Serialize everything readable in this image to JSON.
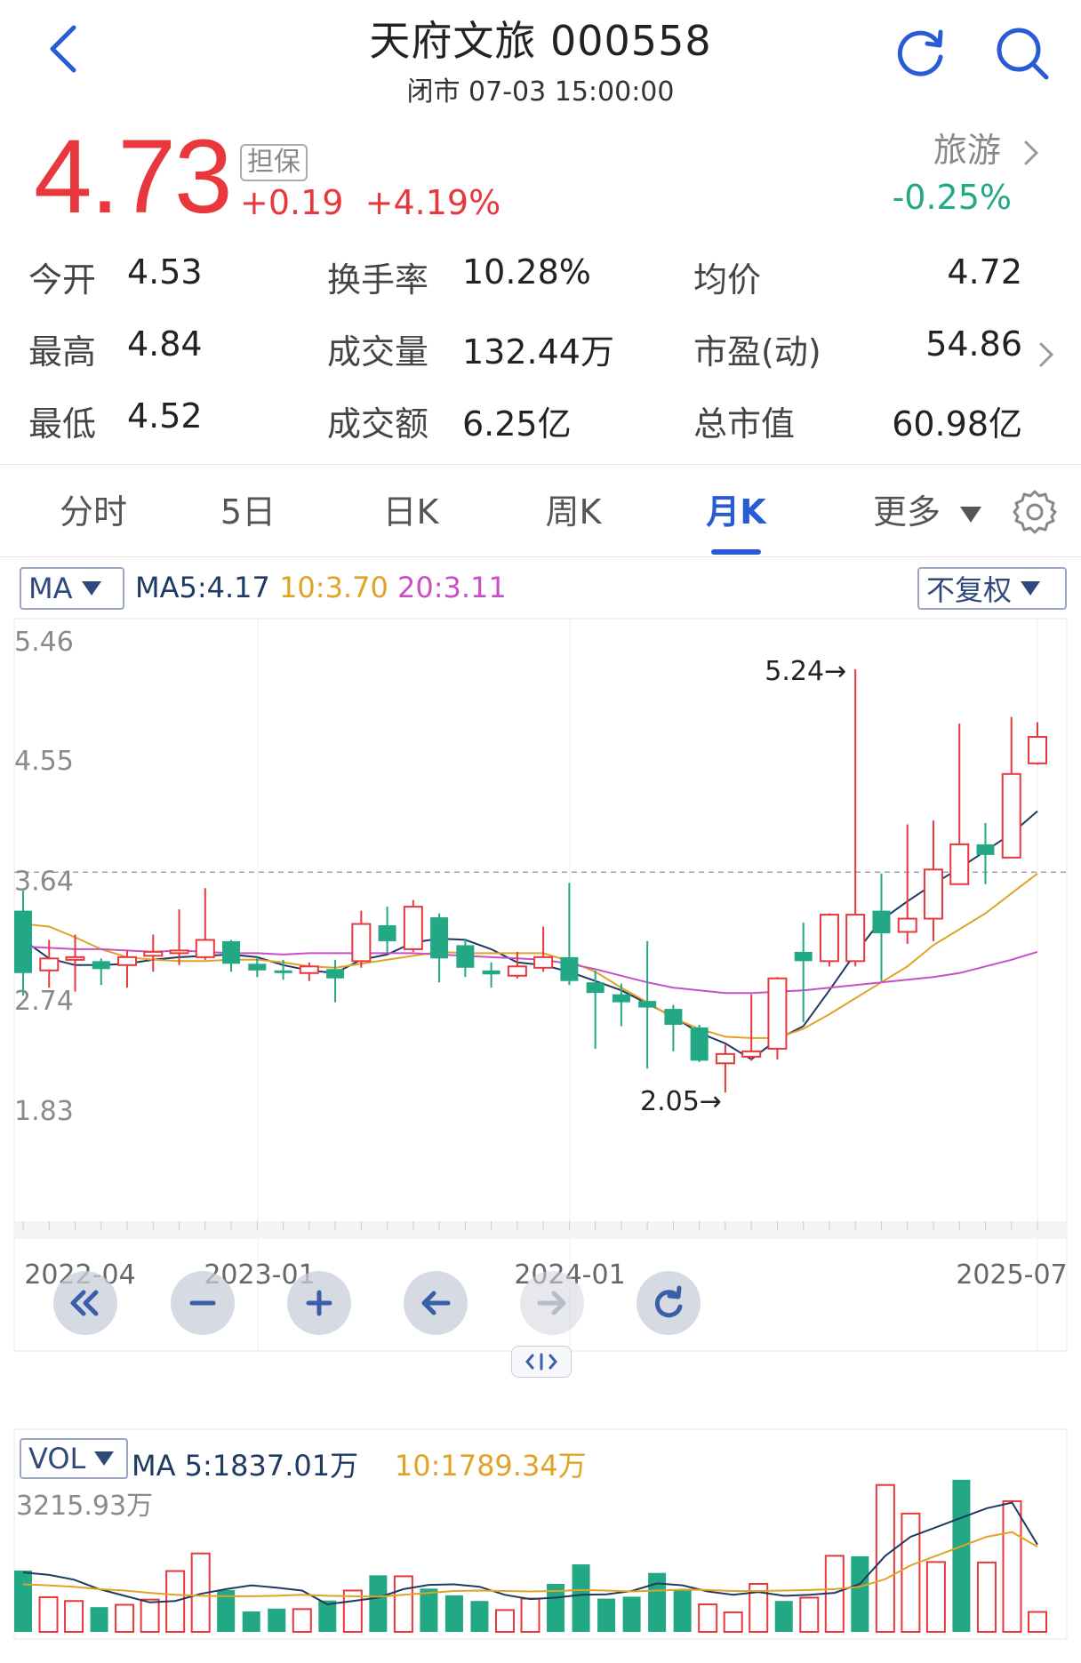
{
  "header": {
    "title": "天府文旅 000558",
    "subtitle": "闭市 07-03 15:00:00",
    "back_icon": "chevron-left-icon",
    "refresh_icon": "refresh-icon",
    "search_icon": "search-icon"
  },
  "quote": {
    "price": "4.73",
    "badge": "担保",
    "change": "+0.19",
    "change_pct": "+4.19%",
    "sector": "旅游",
    "sector_change": "-0.25%"
  },
  "stats": [
    {
      "label": "今开",
      "value": "4.53",
      "tone": "green"
    },
    {
      "label": "换手率",
      "value": "10.28%",
      "tone": "plain"
    },
    {
      "label": "均价",
      "value": "4.72",
      "tone": "red"
    },
    {
      "label": "最高",
      "value": "4.84",
      "tone": "red"
    },
    {
      "label": "成交量",
      "value": "132.44万",
      "tone": "plain"
    },
    {
      "label": "市盈(动)",
      "value": "54.86",
      "tone": "plain"
    },
    {
      "label": "最低",
      "value": "4.52",
      "tone": "green"
    },
    {
      "label": "成交额",
      "value": "6.25亿",
      "tone": "plain"
    },
    {
      "label": "总市值",
      "value": "60.98亿",
      "tone": "plain"
    }
  ],
  "tabs": [
    {
      "label": "分时",
      "active": false
    },
    {
      "label": "5日",
      "active": false
    },
    {
      "label": "日K",
      "active": false
    },
    {
      "label": "周K",
      "active": false
    },
    {
      "label": "月K",
      "active": true
    },
    {
      "label": "更多",
      "active": false
    }
  ],
  "chart_controls": {
    "indicator": "MA",
    "ma5": "MA5:4.17",
    "ma10": "10:3.70",
    "ma20": "20:3.11",
    "adjust": "不复权",
    "vol_indicator": "VOL",
    "vol_ma5": "MA 5:1837.01万",
    "vol_ma10": "10:1789.34万"
  },
  "colors": {
    "up": "#e8383d",
    "down": "#22a884",
    "ma5": "#1f3a63",
    "ma10": "#e0a325",
    "ma20": "#c84fc6",
    "accent": "#2a5bd7"
  },
  "chart_data": {
    "type": "candlestick",
    "period": "monthly",
    "y_ticks": [
      "5.46",
      "4.55",
      "3.64",
      "2.74",
      "1.83"
    ],
    "ylim": [
      1.83,
      5.46
    ],
    "x_ticks": [
      "2022-04",
      "2023-01",
      "2024-01",
      "2025-07"
    ],
    "high_marker": "5.24→",
    "low_marker": "2.05→",
    "last_close": 4.73,
    "candles": [
      {
        "o": 3.42,
        "c": 2.95,
        "h": 3.57,
        "l": 2.78
      },
      {
        "o": 2.97,
        "c": 3.06,
        "h": 3.2,
        "l": 2.84
      },
      {
        "o": 3.05,
        "c": 3.07,
        "h": 3.24,
        "l": 2.81
      },
      {
        "o": 3.04,
        "c": 2.98,
        "h": 3.06,
        "l": 2.86
      },
      {
        "o": 3.01,
        "c": 3.07,
        "h": 3.12,
        "l": 2.84
      },
      {
        "o": 3.08,
        "c": 3.11,
        "h": 3.24,
        "l": 2.96
      },
      {
        "o": 3.12,
        "c": 3.12,
        "h": 3.43,
        "l": 3.01
      },
      {
        "o": 3.07,
        "c": 3.2,
        "h": 3.59,
        "l": 3.05
      },
      {
        "o": 3.19,
        "c": 3.02,
        "h": 3.2,
        "l": 2.96
      },
      {
        "o": 3.02,
        "c": 2.97,
        "h": 3.07,
        "l": 2.92
      },
      {
        "o": 2.97,
        "c": 2.96,
        "h": 3.05,
        "l": 2.9
      },
      {
        "o": 2.95,
        "c": 3.0,
        "h": 3.03,
        "l": 2.89
      },
      {
        "o": 2.98,
        "c": 2.91,
        "h": 3.05,
        "l": 2.73
      },
      {
        "o": 3.04,
        "c": 3.32,
        "h": 3.42,
        "l": 2.99
      },
      {
        "o": 3.31,
        "c": 3.19,
        "h": 3.45,
        "l": 3.1
      },
      {
        "o": 3.13,
        "c": 3.45,
        "h": 3.5,
        "l": 3.11
      },
      {
        "o": 3.37,
        "c": 3.06,
        "h": 3.4,
        "l": 2.88
      },
      {
        "o": 3.16,
        "c": 2.99,
        "h": 3.21,
        "l": 2.92
      },
      {
        "o": 2.97,
        "c": 2.94,
        "h": 3.03,
        "l": 2.84
      },
      {
        "o": 2.93,
        "c": 3.0,
        "h": 3.11,
        "l": 2.91
      },
      {
        "o": 2.99,
        "c": 3.07,
        "h": 3.3,
        "l": 2.96
      },
      {
        "o": 3.07,
        "c": 2.89,
        "h": 3.63,
        "l": 2.86
      },
      {
        "o": 2.88,
        "c": 2.8,
        "h": 2.97,
        "l": 2.38
      },
      {
        "o": 2.79,
        "c": 2.73,
        "h": 2.87,
        "l": 2.55
      },
      {
        "o": 2.74,
        "c": 2.69,
        "h": 3.19,
        "l": 2.23
      },
      {
        "o": 2.68,
        "c": 2.56,
        "h": 2.71,
        "l": 2.36
      },
      {
        "o": 2.54,
        "c": 2.29,
        "h": 2.56,
        "l": 2.28
      },
      {
        "o": 2.27,
        "c": 2.34,
        "h": 2.41,
        "l": 2.05
      },
      {
        "o": 2.32,
        "c": 2.36,
        "h": 2.79,
        "l": 2.29
      },
      {
        "o": 2.38,
        "c": 2.91,
        "h": 2.92,
        "l": 2.3
      },
      {
        "o": 3.11,
        "c": 3.04,
        "h": 3.33,
        "l": 2.58
      },
      {
        "o": 3.04,
        "c": 3.39,
        "h": 3.4,
        "l": 3.0
      },
      {
        "o": 3.04,
        "c": 3.39,
        "h": 5.24,
        "l": 3.0
      },
      {
        "o": 3.42,
        "c": 3.25,
        "h": 3.7,
        "l": 2.89
      },
      {
        "o": 3.26,
        "c": 3.36,
        "h": 4.07,
        "l": 3.17
      },
      {
        "o": 3.36,
        "c": 3.73,
        "h": 4.1,
        "l": 3.19
      },
      {
        "o": 3.62,
        "c": 3.92,
        "h": 4.83,
        "l": 3.62
      },
      {
        "o": 3.92,
        "c": 3.84,
        "h": 4.08,
        "l": 3.62
      },
      {
        "o": 3.82,
        "c": 4.45,
        "h": 4.88,
        "l": 3.82
      },
      {
        "o": 4.53,
        "c": 4.73,
        "h": 4.84,
        "l": 4.52
      }
    ],
    "ma5": [
      3.2,
      3.06,
      3.01,
      3.01,
      3.02,
      3.05,
      3.07,
      3.08,
      3.09,
      3.07,
      3.01,
      2.97,
      2.95,
      3.05,
      3.09,
      3.18,
      3.21,
      3.2,
      3.13,
      3.03,
      3.01,
      2.96,
      2.89,
      2.82,
      2.72,
      2.62,
      2.5,
      2.42,
      2.3,
      2.45,
      2.55,
      2.82,
      3.1,
      3.35,
      3.49,
      3.62,
      3.74,
      3.87,
      4.0,
      4.17
    ],
    "ma10": [
      3.32,
      3.3,
      3.22,
      3.13,
      3.07,
      3.05,
      3.04,
      3.04,
      3.05,
      3.05,
      3.03,
      3.0,
      2.99,
      3.02,
      3.05,
      3.08,
      3.11,
      3.1,
      3.1,
      3.1,
      3.1,
      3.04,
      2.96,
      2.84,
      2.73,
      2.61,
      2.53,
      2.47,
      2.46,
      2.46,
      2.53,
      2.64,
      2.76,
      2.88,
      3.0,
      3.16,
      3.28,
      3.4,
      3.55,
      3.7
    ],
    "ma20": [
      3.15,
      3.14,
      3.13,
      3.13,
      3.12,
      3.11,
      3.12,
      3.11,
      3.1,
      3.1,
      3.09,
      3.1,
      3.1,
      3.1,
      3.1,
      3.1,
      3.09,
      3.08,
      3.07,
      3.06,
      3.05,
      3.02,
      2.98,
      2.93,
      2.88,
      2.84,
      2.82,
      2.8,
      2.8,
      2.81,
      2.82,
      2.84,
      2.86,
      2.88,
      2.9,
      2.92,
      2.95,
      3.0,
      3.05,
      3.11
    ],
    "volume": {
      "y_top_label": "3215.93万",
      "max": 3215.93,
      "values": [
        1290,
        730,
        650,
        520,
        570,
        680,
        1280,
        1650,
        880,
        430,
        490,
        480,
        660,
        870,
        1190,
        1170,
        910,
        770,
        650,
        460,
        700,
        1010,
        1420,
        700,
        740,
        1240,
        880,
        580,
        410,
        1010,
        650,
        720,
        1600,
        1590,
        3090,
        2490,
        1470,
        3200,
        1460,
        2750,
        420
      ],
      "ma5": [
        1250,
        1200,
        1100,
        900,
        760,
        620,
        650,
        800,
        900,
        980,
        930,
        870,
        580,
        650,
        720,
        900,
        990,
        1000,
        950,
        780,
        690,
        720,
        780,
        790,
        860,
        1020,
        980,
        850,
        780,
        840,
        760,
        780,
        820,
        1010,
        1600,
        2000,
        2200,
        2400,
        2600,
        2720,
        1837
      ],
      "ma10": [
        1000,
        980,
        950,
        900,
        870,
        820,
        780,
        760,
        750,
        750,
        760,
        780,
        760,
        750,
        740,
        780,
        820,
        860,
        870,
        860,
        850,
        860,
        880,
        870,
        850,
        870,
        890,
        880,
        860,
        860,
        870,
        880,
        900,
        950,
        1110,
        1400,
        1600,
        1800,
        2000,
        2100,
        1789
      ]
    }
  }
}
